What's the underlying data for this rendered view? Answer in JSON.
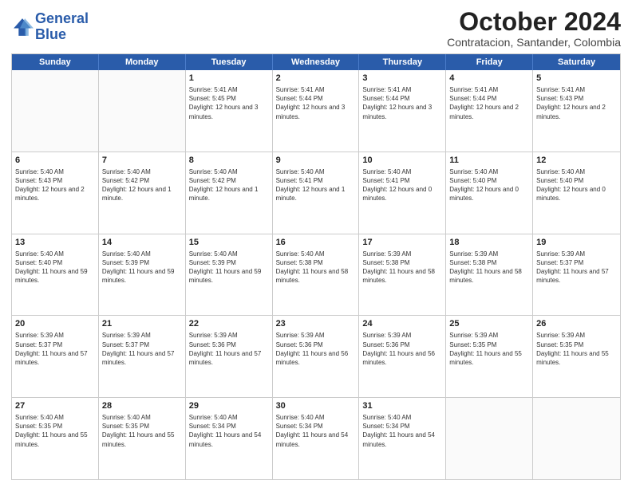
{
  "header": {
    "logo_line1": "General",
    "logo_line2": "Blue",
    "title": "October 2024",
    "subtitle": "Contratacion, Santander, Colombia"
  },
  "days_of_week": [
    "Sunday",
    "Monday",
    "Tuesday",
    "Wednesday",
    "Thursday",
    "Friday",
    "Saturday"
  ],
  "weeks": [
    [
      {
        "day": "",
        "text": "",
        "empty": true
      },
      {
        "day": "",
        "text": "",
        "empty": true
      },
      {
        "day": "1",
        "text": "Sunrise: 5:41 AM\nSunset: 5:45 PM\nDaylight: 12 hours and 3 minutes."
      },
      {
        "day": "2",
        "text": "Sunrise: 5:41 AM\nSunset: 5:44 PM\nDaylight: 12 hours and 3 minutes."
      },
      {
        "day": "3",
        "text": "Sunrise: 5:41 AM\nSunset: 5:44 PM\nDaylight: 12 hours and 3 minutes."
      },
      {
        "day": "4",
        "text": "Sunrise: 5:41 AM\nSunset: 5:44 PM\nDaylight: 12 hours and 2 minutes."
      },
      {
        "day": "5",
        "text": "Sunrise: 5:41 AM\nSunset: 5:43 PM\nDaylight: 12 hours and 2 minutes."
      }
    ],
    [
      {
        "day": "6",
        "text": "Sunrise: 5:40 AM\nSunset: 5:43 PM\nDaylight: 12 hours and 2 minutes."
      },
      {
        "day": "7",
        "text": "Sunrise: 5:40 AM\nSunset: 5:42 PM\nDaylight: 12 hours and 1 minute."
      },
      {
        "day": "8",
        "text": "Sunrise: 5:40 AM\nSunset: 5:42 PM\nDaylight: 12 hours and 1 minute."
      },
      {
        "day": "9",
        "text": "Sunrise: 5:40 AM\nSunset: 5:41 PM\nDaylight: 12 hours and 1 minute."
      },
      {
        "day": "10",
        "text": "Sunrise: 5:40 AM\nSunset: 5:41 PM\nDaylight: 12 hours and 0 minutes."
      },
      {
        "day": "11",
        "text": "Sunrise: 5:40 AM\nSunset: 5:40 PM\nDaylight: 12 hours and 0 minutes."
      },
      {
        "day": "12",
        "text": "Sunrise: 5:40 AM\nSunset: 5:40 PM\nDaylight: 12 hours and 0 minutes."
      }
    ],
    [
      {
        "day": "13",
        "text": "Sunrise: 5:40 AM\nSunset: 5:40 PM\nDaylight: 11 hours and 59 minutes."
      },
      {
        "day": "14",
        "text": "Sunrise: 5:40 AM\nSunset: 5:39 PM\nDaylight: 11 hours and 59 minutes."
      },
      {
        "day": "15",
        "text": "Sunrise: 5:40 AM\nSunset: 5:39 PM\nDaylight: 11 hours and 59 minutes."
      },
      {
        "day": "16",
        "text": "Sunrise: 5:40 AM\nSunset: 5:38 PM\nDaylight: 11 hours and 58 minutes."
      },
      {
        "day": "17",
        "text": "Sunrise: 5:39 AM\nSunset: 5:38 PM\nDaylight: 11 hours and 58 minutes."
      },
      {
        "day": "18",
        "text": "Sunrise: 5:39 AM\nSunset: 5:38 PM\nDaylight: 11 hours and 58 minutes."
      },
      {
        "day": "19",
        "text": "Sunrise: 5:39 AM\nSunset: 5:37 PM\nDaylight: 11 hours and 57 minutes."
      }
    ],
    [
      {
        "day": "20",
        "text": "Sunrise: 5:39 AM\nSunset: 5:37 PM\nDaylight: 11 hours and 57 minutes."
      },
      {
        "day": "21",
        "text": "Sunrise: 5:39 AM\nSunset: 5:37 PM\nDaylight: 11 hours and 57 minutes."
      },
      {
        "day": "22",
        "text": "Sunrise: 5:39 AM\nSunset: 5:36 PM\nDaylight: 11 hours and 57 minutes."
      },
      {
        "day": "23",
        "text": "Sunrise: 5:39 AM\nSunset: 5:36 PM\nDaylight: 11 hours and 56 minutes."
      },
      {
        "day": "24",
        "text": "Sunrise: 5:39 AM\nSunset: 5:36 PM\nDaylight: 11 hours and 56 minutes."
      },
      {
        "day": "25",
        "text": "Sunrise: 5:39 AM\nSunset: 5:35 PM\nDaylight: 11 hours and 55 minutes."
      },
      {
        "day": "26",
        "text": "Sunrise: 5:39 AM\nSunset: 5:35 PM\nDaylight: 11 hours and 55 minutes."
      }
    ],
    [
      {
        "day": "27",
        "text": "Sunrise: 5:40 AM\nSunset: 5:35 PM\nDaylight: 11 hours and 55 minutes."
      },
      {
        "day": "28",
        "text": "Sunrise: 5:40 AM\nSunset: 5:35 PM\nDaylight: 11 hours and 55 minutes."
      },
      {
        "day": "29",
        "text": "Sunrise: 5:40 AM\nSunset: 5:34 PM\nDaylight: 11 hours and 54 minutes."
      },
      {
        "day": "30",
        "text": "Sunrise: 5:40 AM\nSunset: 5:34 PM\nDaylight: 11 hours and 54 minutes."
      },
      {
        "day": "31",
        "text": "Sunrise: 5:40 AM\nSunset: 5:34 PM\nDaylight: 11 hours and 54 minutes."
      },
      {
        "day": "",
        "text": "",
        "empty": true
      },
      {
        "day": "",
        "text": "",
        "empty": true
      }
    ]
  ]
}
